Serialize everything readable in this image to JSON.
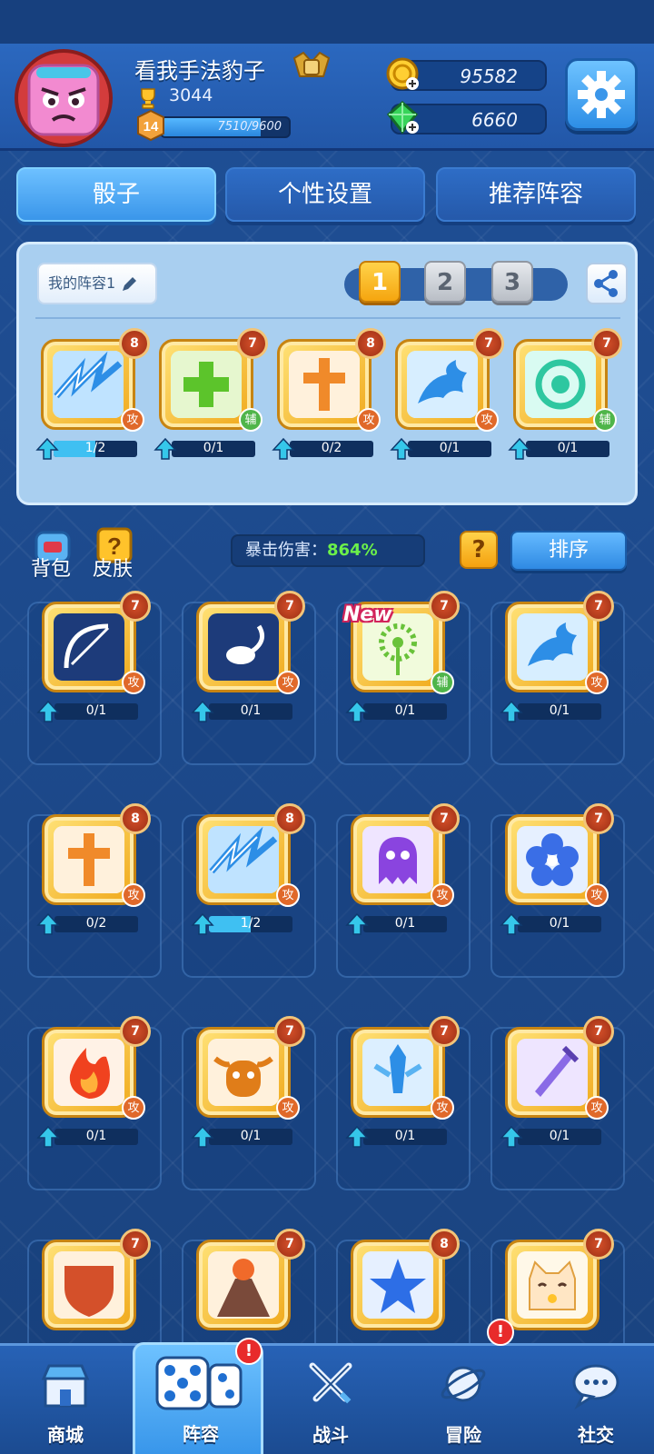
{
  "player": {
    "name": "看我手法豹子",
    "trophies": "3044",
    "level": "14",
    "xp": "7510/9600",
    "xp_progress": 0.78
  },
  "currency": {
    "gold": "95582",
    "gems": "6660"
  },
  "tabs": [
    {
      "label": "骰子",
      "active": true
    },
    {
      "label": "个性设置",
      "active": false
    },
    {
      "label": "推荐阵容",
      "active": false
    }
  ],
  "deck": {
    "name_button": "我的阵容1",
    "slots": [
      "1",
      "2",
      "3"
    ],
    "active_slot": "1",
    "cards": [
      {
        "icon": "lightning-icon",
        "level": "8",
        "role": "攻",
        "progress": "1/2",
        "fill": 0.5
      },
      {
        "icon": "plus-cross-icon",
        "level": "7",
        "role": "辅",
        "progress": "0/1",
        "fill": 0
      },
      {
        "icon": "holy-cross-icon",
        "level": "8",
        "role": "攻",
        "progress": "0/2",
        "fill": 0
      },
      {
        "icon": "dragon-icon",
        "level": "7",
        "role": "攻",
        "progress": "0/1",
        "fill": 0
      },
      {
        "icon": "spiral-wind-icon",
        "level": "7",
        "role": "辅",
        "progress": "0/1",
        "fill": 0
      }
    ]
  },
  "toolbar": {
    "bag_label": "背包",
    "skin_label": "皮肤",
    "crit_label": "暴击伤害：",
    "crit_value": "864%",
    "help_label": "?",
    "sort_label": "排序"
  },
  "collection": {
    "new_tag": "New",
    "cards": [
      {
        "icon": "bow-icon",
        "level": "7",
        "role": "攻",
        "progress": "0/1",
        "fill": 0
      },
      {
        "icon": "scorpion-icon",
        "level": "7",
        "role": "攻",
        "progress": "0/1",
        "fill": 0
      },
      {
        "icon": "dandelion-icon",
        "level": "7",
        "role": "辅",
        "progress": "0/1",
        "fill": 0
      },
      {
        "icon": "dragon-icon",
        "level": "7",
        "role": "攻",
        "progress": "0/1",
        "fill": 0
      },
      {
        "icon": "holy-cross-icon",
        "level": "8",
        "role": "攻",
        "progress": "0/2",
        "fill": 0
      },
      {
        "icon": "lightning-icon",
        "level": "8",
        "role": "攻",
        "progress": "1/2",
        "fill": 0.5
      },
      {
        "icon": "ghost-icon",
        "level": "7",
        "role": "攻",
        "progress": "0/1",
        "fill": 0
      },
      {
        "icon": "flower-icon",
        "level": "7",
        "role": "攻",
        "progress": "0/1",
        "fill": 0
      },
      {
        "icon": "fire-icon",
        "level": "7",
        "role": "攻",
        "progress": "0/1",
        "fill": 0
      },
      {
        "icon": "bull-icon",
        "level": "7",
        "role": "攻",
        "progress": "0/1",
        "fill": 0
      },
      {
        "icon": "ice-sword-icon",
        "level": "7",
        "role": "攻",
        "progress": "0/1",
        "fill": 0
      },
      {
        "icon": "purple-sword-icon",
        "level": "7",
        "role": "攻",
        "progress": "0/1",
        "fill": 0
      },
      {
        "icon": "shield-icon",
        "level": "7",
        "role": "",
        "progress": "",
        "fill": 0
      },
      {
        "icon": "volcano-icon",
        "level": "7",
        "role": "",
        "progress": "",
        "fill": 0
      },
      {
        "icon": "star-icon",
        "level": "8",
        "role": "",
        "progress": "",
        "fill": 0
      },
      {
        "icon": "lucky-cat-icon",
        "level": "7",
        "role": "",
        "progress": "",
        "fill": 0
      }
    ]
  },
  "nav": [
    {
      "label": "商城",
      "icon": "shop-icon"
    },
    {
      "label": "阵容",
      "icon": "dice-icon",
      "active": true,
      "alert": "!"
    },
    {
      "label": "战斗",
      "icon": "crossed-swords-icon"
    },
    {
      "label": "冒险",
      "icon": "planet-icon",
      "alert": "!"
    },
    {
      "label": "社交",
      "icon": "chat-icon"
    }
  ]
}
